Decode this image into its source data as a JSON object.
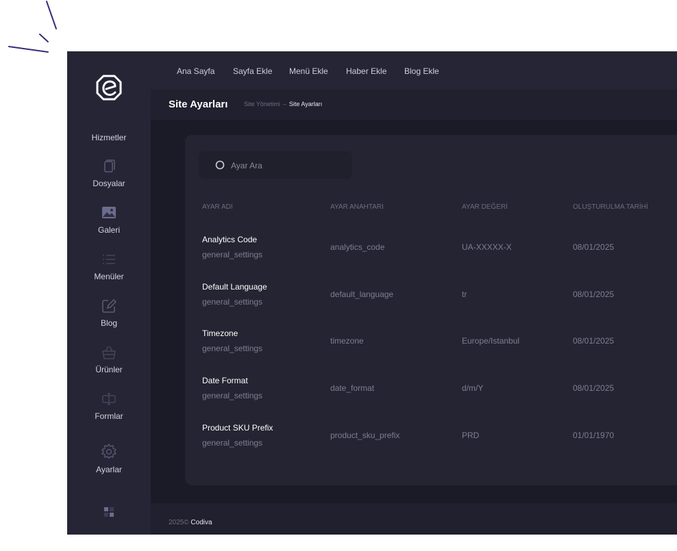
{
  "header": {
    "nav": [
      "Ana Sayfa",
      "Sayfa Ekle",
      "Menü Ekle",
      "Haber Ekle",
      "Blog Ekle"
    ],
    "page_title": "Site Ayarları",
    "breadcrumb": [
      "Site Yönetimi",
      "Site Ayarları"
    ]
  },
  "sidebar": {
    "top_label": "Hizmetler",
    "items": [
      {
        "label": "Dosyalar",
        "icon": "file-icon"
      },
      {
        "label": "Galeri",
        "icon": "image-icon"
      },
      {
        "label": "Menüler",
        "icon": "list-icon"
      },
      {
        "label": "Blog",
        "icon": "edit-icon"
      },
      {
        "label": "Ürünler",
        "icon": "basket-icon"
      },
      {
        "label": "Formlar",
        "icon": "form-icon"
      },
      {
        "label": "Ayarlar",
        "icon": "gear-icon"
      }
    ],
    "bottom_icon": "grid-icon"
  },
  "search": {
    "placeholder": "Ayar Ara"
  },
  "table": {
    "columns": [
      "AYAR ADI",
      "AYAR ANAHTARI",
      "AYAR DEĞERİ",
      "OLUŞTURULMA TARİHİ"
    ],
    "rows": [
      {
        "name": "Analytics Code",
        "group": "general_settings",
        "key": "analytics_code",
        "value": "UA-XXXXX-X",
        "date": "08/01/2025"
      },
      {
        "name": "Default Language",
        "group": "general_settings",
        "key": "default_language",
        "value": "tr",
        "date": "08/01/2025"
      },
      {
        "name": "Timezone",
        "group": "general_settings",
        "key": "timezone",
        "value": "Europe/Istanbul",
        "date": "08/01/2025"
      },
      {
        "name": "Date Format",
        "group": "general_settings",
        "key": "date_format",
        "value": "d/m/Y",
        "date": "08/01/2025"
      },
      {
        "name": "Product SKU Prefix",
        "group": "general_settings",
        "key": "product_sku_prefix",
        "value": "PRD",
        "date": "01/01/1970"
      }
    ]
  },
  "footer": {
    "year": "2025©",
    "brand": "Codiva"
  },
  "colors": {
    "sidebar_bg": "#252535",
    "content_bg": "#1b1b27",
    "card_bg": "#242432",
    "doodle": "#3b2a7a"
  }
}
